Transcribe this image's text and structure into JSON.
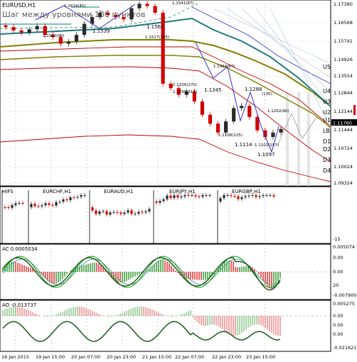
{
  "window": {
    "title": "EURUSD,H1",
    "watermark": "Шаг между уровнями 100 пунктов"
  },
  "colors": {
    "bull": "#2a2a2a",
    "bear": "#d00000",
    "grid": "#b8b8b8",
    "ma_dark": "#1f7a7a",
    "ma_olive": "#808000",
    "ma_red": "#c00000",
    "ma_blue": "#3333cc",
    "ao_up": "#008000",
    "ao_down": "#d00000",
    "last_price_bg": "#000000"
  },
  "chart_data": [
    {
      "type": "line",
      "panel": "main",
      "title": "EURUSD,H1",
      "price_labels": [
        "1.17380",
        "1.16568",
        "1.15741",
        "1.14926",
        "1.13554",
        "1.12844",
        "1.12144",
        "1.11444",
        "1.10724",
        "1.10024",
        "1.09324"
      ],
      "last_price": "1.11760",
      "close": [
        1.1635,
        1.162,
        1.161,
        1.1625,
        1.164,
        1.16,
        1.159,
        1.156,
        1.157,
        1.16,
        1.165,
        1.168,
        1.17,
        1.169,
        1.168,
        1.167,
        1.172,
        1.174,
        1.173,
        1.17,
        1.138,
        1.136,
        1.133,
        1.1345,
        1.13,
        1.124,
        1.12,
        1.116,
        1.121,
        1.127,
        1.128,
        1.123,
        1.117,
        1.114,
        1.116,
        1.1176
      ],
      "level_labels": [
        "U5",
        "U4",
        "U3",
        "U2",
        "U1",
        "LB",
        "D1",
        "D2",
        "D3",
        "D4"
      ],
      "annotations": [
        "1.1624(45)",
        "1.1530(90)",
        "1.1539",
        "1.1541(87)",
        "1.1561",
        "1.1517(105)",
        "1.1364(67)",
        "1.1326(270)",
        "1.1299(315)",
        "1.1345",
        "1.1288",
        "(135)",
        "1.1202(90)",
        "1.1108(225)",
        "1.1114",
        "1.1102(157)",
        "1.1097"
      ]
    },
    {
      "type": "bar",
      "panel": "crosses",
      "title": "HIFS",
      "series": [
        {
          "name": "EURCHF,H1"
        },
        {
          "name": "EURAUD,H1"
        },
        {
          "name": "EURJPY,H1"
        },
        {
          "name": "EURGBP,H1"
        }
      ],
      "y_label": "-15"
    },
    {
      "type": "line",
      "panel": "AC",
      "title": "AC 0.0005034",
      "price_labels": [
        "0.005074",
        "0.00",
        "0.00",
        "20",
        "-0.007900"
      ]
    },
    {
      "type": "bar",
      "panel": "AO",
      "title": "AO -0.013737",
      "price_labels": [
        "0.005275",
        "0.00",
        "0.00",
        "0.00",
        "-0.021621"
      ]
    }
  ],
  "time_axis": [
    "16 Jan 2015",
    "19 Jan 15:00",
    "20 Jan 07:00",
    "20 Jan 23:00",
    "21 Jan 15:00",
    "22 Jan 07:00",
    "22 Jan 23:00",
    "23 Jan 15:00"
  ]
}
